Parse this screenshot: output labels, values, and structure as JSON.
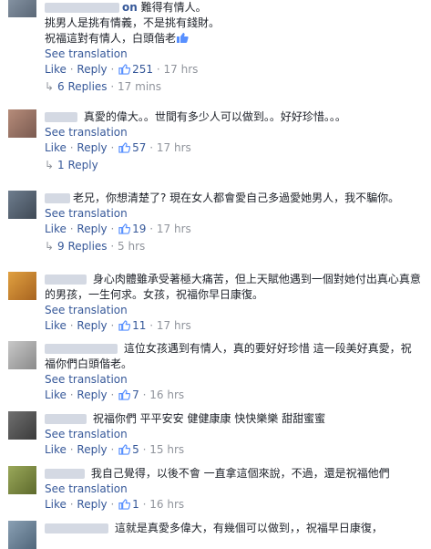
{
  "comments": [
    {
      "name_suffix": "on",
      "lines": [
        "難得有情人。",
        "挑男人是挑有情義，不是挑有錢財。",
        "祝福這對有情人，白頭偕老"
      ],
      "see_translation": "See translation",
      "like": "Like",
      "sep": "·",
      "reply": "Reply",
      "likes": "251",
      "time": "17 hrs",
      "replies": "6 Replies",
      "replies_time": "17 mins"
    },
    {
      "lines": [
        "真愛的偉大。。世間有多少人可以做到。。好好珍惜。。。"
      ],
      "see_translation": "See translation",
      "like": "Like",
      "sep": "·",
      "reply": "Reply",
      "likes": "57",
      "time": "17 hrs",
      "replies": "1 Reply",
      "replies_time": ""
    },
    {
      "lines": [
        "老兄，你想清楚了? 現在女人都會愛自己多過愛她男人，我不騙你。"
      ],
      "see_translation": "See translation",
      "like": "Like",
      "sep": "·",
      "reply": "Reply",
      "likes": "19",
      "time": "17 hrs",
      "replies": "9 Replies",
      "replies_time": "5 hrs"
    },
    {
      "lines": [
        "身心肉體雖承受著極大痛苦，但上天賦他遇到一個對她付出真心真意",
        "的男孩，一生何求。女孩，祝福你早日康復。"
      ],
      "see_translation": "See translation",
      "like": "Like",
      "sep": "·",
      "reply": "Reply",
      "likes": "11",
      "time": "17 hrs"
    },
    {
      "lines": [
        "這位女孩遇到有情人，真的要好好珍惜 這一段美好真愛，祝",
        "福你們白頭偕老。"
      ],
      "see_translation": "See translation",
      "like": "Like",
      "sep": "·",
      "reply": "Reply",
      "likes": "7",
      "time": "16 hrs"
    },
    {
      "lines": [
        "祝福你們 平平安安 健健康康 快快樂樂 甜甜蜜蜜"
      ],
      "see_translation": "See translation",
      "like": "Like",
      "sep": "·",
      "reply": "Reply",
      "likes": "5",
      "time": "15 hrs"
    },
    {
      "lines": [
        "我自己覺得，以後不會 一直拿這個來說，不過，還是祝福他們"
      ],
      "see_translation": "See translation",
      "like": "Like",
      "sep": "·",
      "reply": "Reply",
      "likes": "1",
      "time": "16 hrs"
    },
    {
      "lines": [
        "這就是真愛多偉大，有幾個可以做到，，祝福早日康復，"
      ]
    }
  ],
  "colors": {
    "link": "#365899",
    "meta": "#90949c",
    "text": "#1d2129"
  }
}
